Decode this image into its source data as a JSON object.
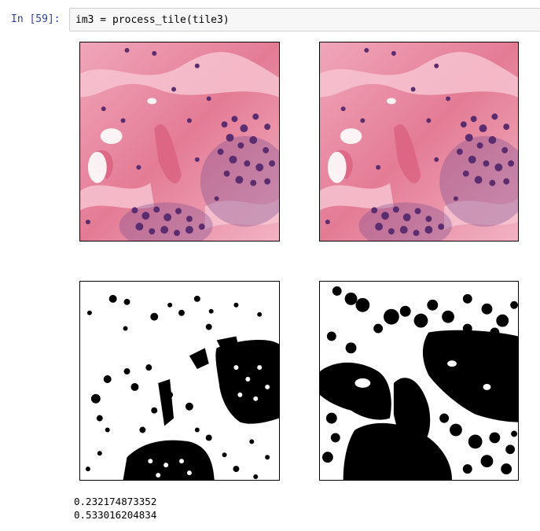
{
  "cell": {
    "prompt": "In [59]:",
    "code": "im3 = process_tile(tile3)"
  },
  "figure": {
    "panels": [
      {
        "name": "original-tile",
        "kind": "he-stain-image"
      },
      {
        "name": "processed-tile",
        "kind": "he-stain-image"
      },
      {
        "name": "binary-mask",
        "kind": "black-white-mask"
      },
      {
        "name": "dilated-mask",
        "kind": "black-white-mask"
      }
    ],
    "colors": {
      "stroma_pink": "#e8889e",
      "nuclei_purple": "#6a3a7a",
      "mask_black": "#000000",
      "mask_white": "#ffffff"
    }
  },
  "output": {
    "lines": [
      "0.232174873352",
      "0.533016204834"
    ]
  }
}
